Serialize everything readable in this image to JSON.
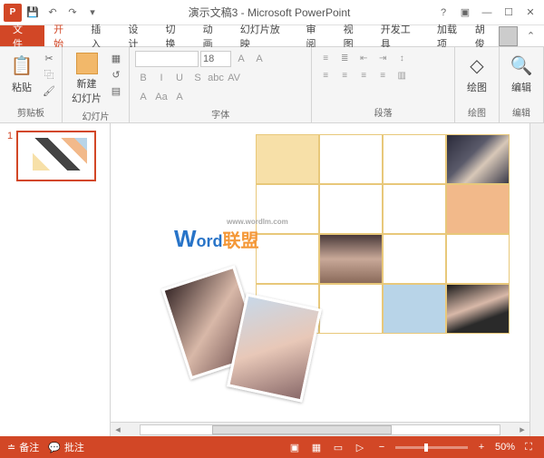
{
  "titlebar": {
    "app_badge": "P",
    "title": "演示文稿3 - Microsoft PowerPoint"
  },
  "tabs": {
    "file": "文件",
    "items": [
      "开始",
      "插入",
      "设计",
      "切换",
      "动画",
      "幻灯片放映",
      "审阅",
      "视图",
      "开发工具",
      "加载项"
    ],
    "active_index": 0,
    "user": "胡俊"
  },
  "ribbon": {
    "clipboard": {
      "label": "剪贴板",
      "paste": "粘贴"
    },
    "slides": {
      "label": "幻灯片",
      "new_slide": "新建\n幻灯片"
    },
    "font": {
      "label": "字体",
      "size": "18",
      "btns": [
        "B",
        "I",
        "U",
        "S",
        "abc",
        "AV"
      ],
      "btns2": [
        "A",
        "Aa",
        "A"
      ]
    },
    "paragraph": {
      "label": "段落"
    },
    "drawing": {
      "label": "绘图",
      "btn": "绘图"
    },
    "editing": {
      "label": "编辑",
      "btn": "编辑"
    }
  },
  "thumbs": {
    "num": "1"
  },
  "watermark": {
    "w": "W",
    "ord": "ord",
    "cn": "联盟",
    "url": "www.wordlm.com"
  },
  "statusbar": {
    "notes": "备注",
    "comments": "批注",
    "zoom": "50%"
  }
}
